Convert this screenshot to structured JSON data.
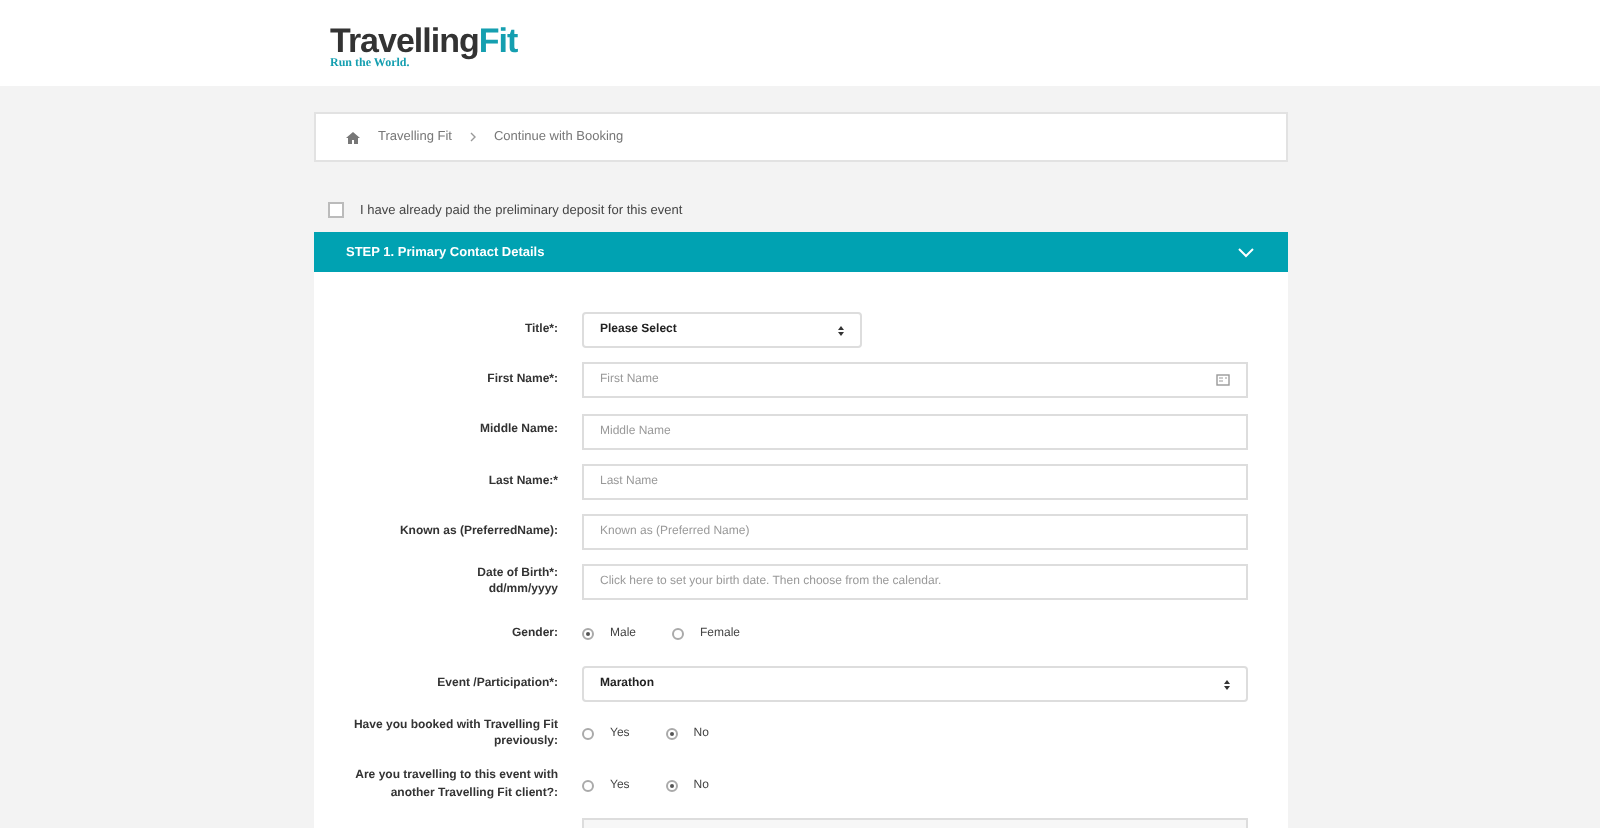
{
  "logo": {
    "word": "Travelling",
    "accent": "Fit",
    "tagline": "Run the World."
  },
  "breadcrumb": [
    "Travelling Fit",
    "Continue with Booking"
  ],
  "deposit": {
    "label": "I have already paid the preliminary deposit for this event",
    "checked": false
  },
  "step": {
    "title": "STEP 1. Primary Contact Details",
    "expanded": true
  },
  "fields": [
    {
      "kind": "short_select",
      "label": [
        "Title*:"
      ],
      "value": "Please Select"
    },
    {
      "kind": "card_text",
      "label": [
        "First Name*:"
      ],
      "placeholder": "First Name"
    },
    {
      "kind": "text",
      "label": [
        "Middle Name:"
      ],
      "placeholder": "Middle Name"
    },
    {
      "kind": "text",
      "label": [
        "Last Name:*"
      ],
      "placeholder": "Last Name"
    },
    {
      "kind": "text",
      "label": [
        "Known as (PreferredName):"
      ],
      "placeholder": "Known as (Preferred Name)"
    },
    {
      "kind": "text",
      "label": [
        "Date of Birth*:",
        "dd/mm/yyyy"
      ],
      "placeholder": "Click here to set your birth date. Then choose from the calendar."
    },
    {
      "kind": "radio",
      "label": [
        "Gender:"
      ],
      "options": [
        {
          "label": "Male",
          "selected": true
        },
        {
          "label": "Female",
          "selected": false
        }
      ]
    },
    {
      "kind": "select",
      "label": [
        "Event /Participation*:"
      ],
      "value": "Marathon"
    },
    {
      "kind": "radio",
      "label": [
        "Have you booked with Travelling Fit",
        "previously:"
      ],
      "options": [
        {
          "label": "Yes",
          "selected": false
        },
        {
          "label": "No",
          "selected": true
        }
      ]
    },
    {
      "kind": "radio",
      "label": [
        "Are you travelling to this event with",
        "another Travelling Fit client?:"
      ],
      "options": [
        {
          "label": "Yes",
          "selected": false
        },
        {
          "label": "No",
          "selected": true
        }
      ]
    },
    {
      "kind": "blank"
    }
  ]
}
